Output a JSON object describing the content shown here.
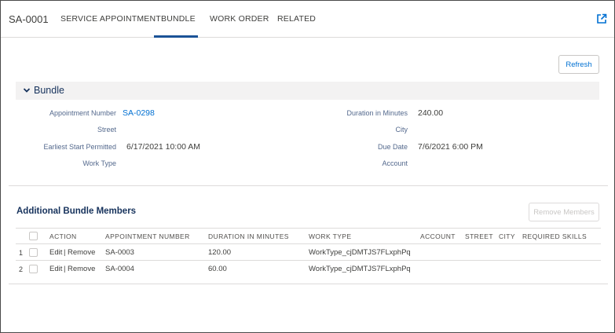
{
  "tabs": {
    "record_id": "SA-0001",
    "items": [
      "SERVICE APPOINTMENT",
      "BUNDLE",
      "WORK ORDER",
      "RELATED"
    ],
    "active": "BUNDLE",
    "popout_icon": "external-link-icon"
  },
  "refresh_label": "Refresh",
  "section": {
    "title": "Bundle",
    "chevron_icon": "chevron-down-icon"
  },
  "fields": {
    "appointment_number": {
      "label": "Appointment Number",
      "value": "SA-0298"
    },
    "street": {
      "label": "Street",
      "value": ""
    },
    "earliest_start": {
      "label": "Earliest Start Permitted",
      "value": "6/17/2021 10:00 AM"
    },
    "work_type": {
      "label": "Work Type",
      "value": ""
    },
    "duration": {
      "label": "Duration in Minutes",
      "value": "240.00"
    },
    "city": {
      "label": "City",
      "value": ""
    },
    "due_date": {
      "label": "Due Date",
      "value": "7/6/2021 6:00 PM"
    },
    "account": {
      "label": "Account",
      "value": ""
    }
  },
  "additional": {
    "title": "Additional Bundle Members",
    "remove_label": "Remove Members",
    "columns": [
      "ACTION",
      "APPOINTMENT NUMBER",
      "DURATION IN MINUTES",
      "WORK TYPE",
      "ACCOUNT",
      "STREET",
      "CITY",
      "REQUIRED SKILLS"
    ],
    "rows": [
      {
        "num": "1",
        "edit": "Edit",
        "sep": "|",
        "remove": "Remove",
        "appt": "SA-0003",
        "duration": "120.00",
        "work_type": "WorkType_cjDMTJS7FLxphPq"
      },
      {
        "num": "2",
        "edit": "Edit",
        "sep": "|",
        "remove": "Remove",
        "appt": "SA-0004",
        "duration": "60.00",
        "work_type": "WorkType_cjDMTJS7FLxphPq"
      }
    ]
  },
  "colors": {
    "link": "#0070d2",
    "active_underline": "#1b5297",
    "section_bg": "#f3f2f2",
    "heading": "#16325c"
  }
}
